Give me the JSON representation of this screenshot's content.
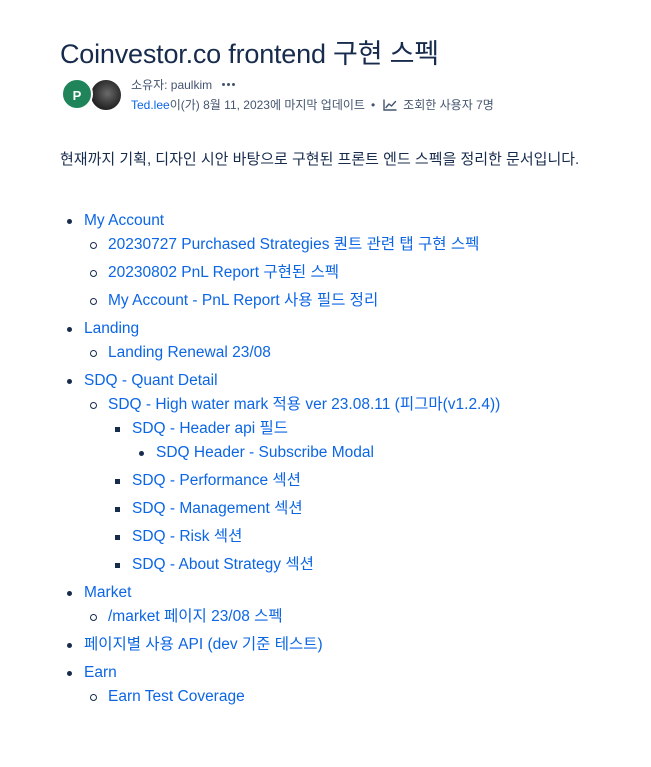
{
  "page": {
    "title": "Coinvestor.co frontend 구현 스펙",
    "description": "현재까지 기획, 디자인 시안 바탕으로 구현된 프론트 엔드 스펙을 정리한 문서입니다."
  },
  "byline": {
    "avatar_initial": "P",
    "owner_text": "소유자: paulkim",
    "editor_link": "Ted.lee",
    "updated_text": "이(가) 8월 11, 2023에 마지막 업데이트",
    "separator": "•",
    "views_text": "조회한 사용자 7명",
    "icons": {
      "more": "more-horizontal-icon",
      "views": "analytics-chart-icon"
    },
    "colors": {
      "avatar_bg": "#1f845a",
      "link": "#0c66e4"
    }
  },
  "tree": [
    {
      "label": "My Account",
      "children": [
        {
          "label": "20230727 Purchased Strategies 퀀트 관련 탭 구현 스펙"
        },
        {
          "label": "20230802 PnL Report 구현된 스펙"
        },
        {
          "label": "My Account - PnL Report 사용 필드 정리"
        }
      ]
    },
    {
      "label": "Landing",
      "children": [
        {
          "label": "Landing Renewal 23/08"
        }
      ]
    },
    {
      "label": "SDQ - Quant Detail",
      "children": [
        {
          "label": "SDQ - High water mark 적용 ver 23.08.11 (피그마(v1.2.4))",
          "children": [
            {
              "label": "SDQ - Header api 필드",
              "children": [
                {
                  "label": "SDQ Header - Subscribe Modal"
                }
              ]
            },
            {
              "label": "SDQ - Performance 섹션"
            },
            {
              "label": "SDQ - Management 섹션"
            },
            {
              "label": "SDQ - Risk 섹션"
            },
            {
              "label": "SDQ - About Strategy 섹션"
            }
          ]
        }
      ]
    },
    {
      "label": "Market",
      "children": [
        {
          "label": "/market 페이지 23/08 스펙"
        }
      ]
    },
    {
      "label": "페이지별 사용 API (dev 기준 테스트)",
      "children": []
    },
    {
      "label": "Earn",
      "children": [
        {
          "label": "Earn Test Coverage"
        }
      ]
    }
  ]
}
